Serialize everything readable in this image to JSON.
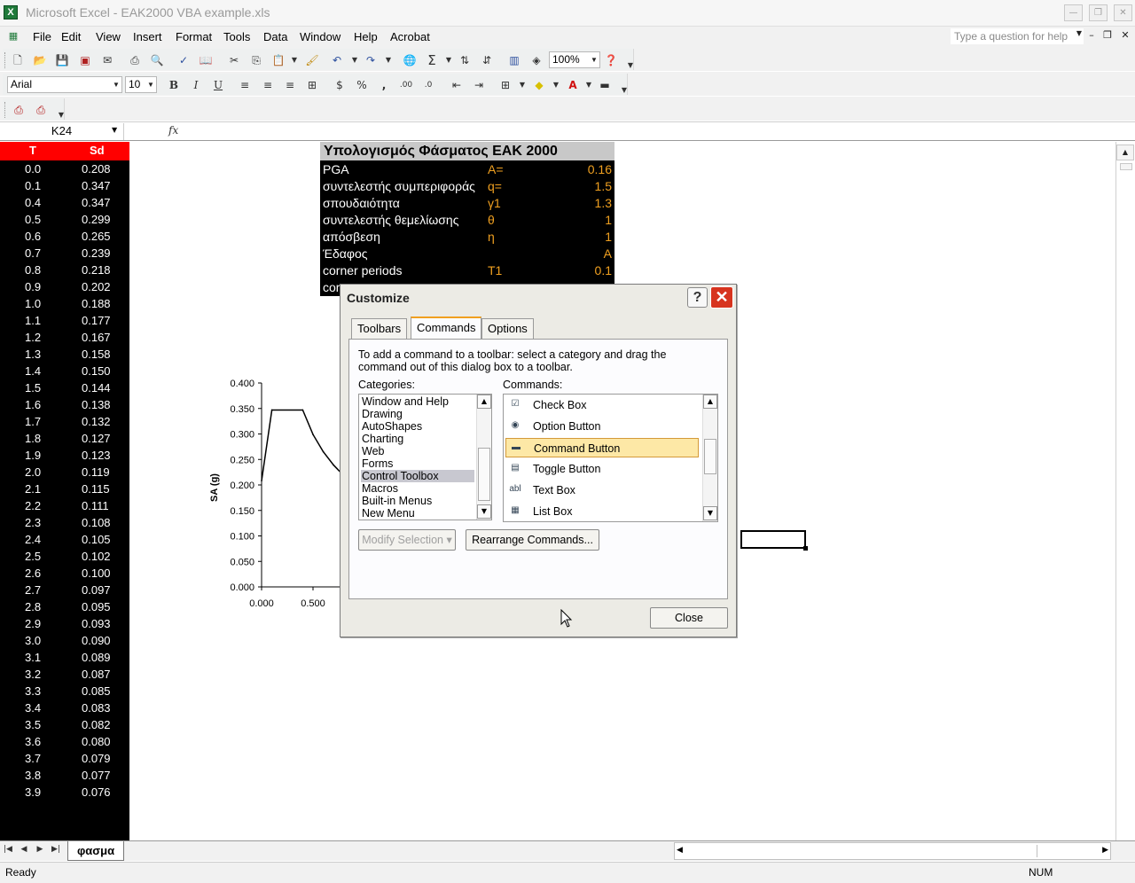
{
  "window": {
    "title": "Microsoft Excel - EAK2000 VBA example.xls",
    "app_icon": "X"
  },
  "menu": {
    "items": [
      "File",
      "Edit",
      "View",
      "Insert",
      "Format",
      "Tools",
      "Data",
      "Window",
      "Help",
      "Acrobat"
    ],
    "ask_placeholder": "Type a question for help"
  },
  "toolbar": {
    "zoom": "100%",
    "font_name": "Arial",
    "font_size": "10"
  },
  "formula_bar": {
    "name_box": "K24",
    "fx": "fx"
  },
  "sheet": {
    "table": {
      "header_T": "T",
      "header_Sd": "Sd",
      "rows": [
        [
          "0.0",
          "0.208"
        ],
        [
          "0.1",
          "0.347"
        ],
        [
          "0.4",
          "0.347"
        ],
        [
          "0.5",
          "0.299"
        ],
        [
          "0.6",
          "0.265"
        ],
        [
          "0.7",
          "0.239"
        ],
        [
          "0.8",
          "0.218"
        ],
        [
          "0.9",
          "0.202"
        ],
        [
          "1.0",
          "0.188"
        ],
        [
          "1.1",
          "0.177"
        ],
        [
          "1.2",
          "0.167"
        ],
        [
          "1.3",
          "0.158"
        ],
        [
          "1.4",
          "0.150"
        ],
        [
          "1.5",
          "0.144"
        ],
        [
          "1.6",
          "0.138"
        ],
        [
          "1.7",
          "0.132"
        ],
        [
          "1.8",
          "0.127"
        ],
        [
          "1.9",
          "0.123"
        ],
        [
          "2.0",
          "0.119"
        ],
        [
          "2.1",
          "0.115"
        ],
        [
          "2.2",
          "0.111"
        ],
        [
          "2.3",
          "0.108"
        ],
        [
          "2.4",
          "0.105"
        ],
        [
          "2.5",
          "0.102"
        ],
        [
          "2.6",
          "0.100"
        ],
        [
          "2.7",
          "0.097"
        ],
        [
          "2.8",
          "0.095"
        ],
        [
          "2.9",
          "0.093"
        ],
        [
          "3.0",
          "0.090"
        ],
        [
          "3.1",
          "0.089"
        ],
        [
          "3.2",
          "0.087"
        ],
        [
          "3.3",
          "0.085"
        ],
        [
          "3.4",
          "0.083"
        ],
        [
          "3.5",
          "0.082"
        ],
        [
          "3.6",
          "0.080"
        ],
        [
          "3.7",
          "0.079"
        ],
        [
          "3.8",
          "0.077"
        ],
        [
          "3.9",
          "0.076"
        ]
      ]
    },
    "params": {
      "title": "Υπολογισμός Φάσματος ΕΑΚ 2000",
      "rows": [
        {
          "label": "PGA",
          "symbol": "A=",
          "value": "0.16"
        },
        {
          "label": "συντελεστής συμπεριφοράς",
          "symbol": "q=",
          "value": "1.5"
        },
        {
          "label": "σπουδαιότητα",
          "symbol": "γ1",
          "value": "1.3"
        },
        {
          "label": "συντελεστής θεμελίωσης",
          "symbol": "θ",
          "value": "1"
        },
        {
          "label": "απόσβεση",
          "symbol": "η",
          "value": "1"
        },
        {
          "label": "Έδαφος",
          "symbol": "",
          "value": "A"
        },
        {
          "label": "corner periods",
          "symbol": "T1",
          "value": "0.1"
        },
        {
          "label": "cor",
          "symbol": "",
          "value": ""
        }
      ]
    },
    "tab_name": "φασμα"
  },
  "chart_data": {
    "type": "line",
    "ylabel": "SA (g)",
    "xlabel": "",
    "y_ticks": [
      "0.400",
      "0.350",
      "0.300",
      "0.250",
      "0.200",
      "0.150",
      "0.100",
      "0.050",
      "0.000"
    ],
    "x_ticks": [
      "0.000",
      "0.500"
    ],
    "ylim": [
      0,
      0.4
    ],
    "x": [
      0.0,
      0.1,
      0.4,
      0.5,
      0.6,
      0.7,
      0.8
    ],
    "y": [
      0.208,
      0.347,
      0.347,
      0.299,
      0.265,
      0.239,
      0.218
    ]
  },
  "status": {
    "left": "Ready",
    "right": "NUM"
  },
  "dialog": {
    "title": "Customize",
    "help_glyph": "?",
    "close_glyph": "✕",
    "tabs": [
      "Toolbars",
      "Commands",
      "Options"
    ],
    "active_tab": "Commands",
    "instructions": "To add a command to a toolbar: select a category and drag the command out of this dialog box to a toolbar.",
    "categories_label": "Categories:",
    "commands_label": "Commands:",
    "categories": [
      "Window and Help",
      "Drawing",
      "AutoShapes",
      "Charting",
      "Web",
      "Forms",
      "Control Toolbox",
      "Macros",
      "Built-in Menus",
      "New Menu"
    ],
    "selected_category": "Control Toolbox",
    "commands": [
      {
        "icon": "check-box-icon",
        "glyph": "☑",
        "label": "Check Box"
      },
      {
        "icon": "option-button-icon",
        "glyph": "◉",
        "label": "Option Button"
      },
      {
        "icon": "command-button-icon",
        "glyph": "▬",
        "label": "Command Button"
      },
      {
        "icon": "toggle-button-icon",
        "glyph": "▤",
        "label": "Toggle Button"
      },
      {
        "icon": "text-box-icon",
        "glyph": "abl",
        "label": "Text Box"
      },
      {
        "icon": "list-box-icon",
        "glyph": "▦",
        "label": "List Box"
      }
    ],
    "selected_command": "Command Button",
    "modify_selection": "Modify Selection ▾",
    "rearrange": "Rearrange Commands...",
    "close_button": "Close"
  }
}
